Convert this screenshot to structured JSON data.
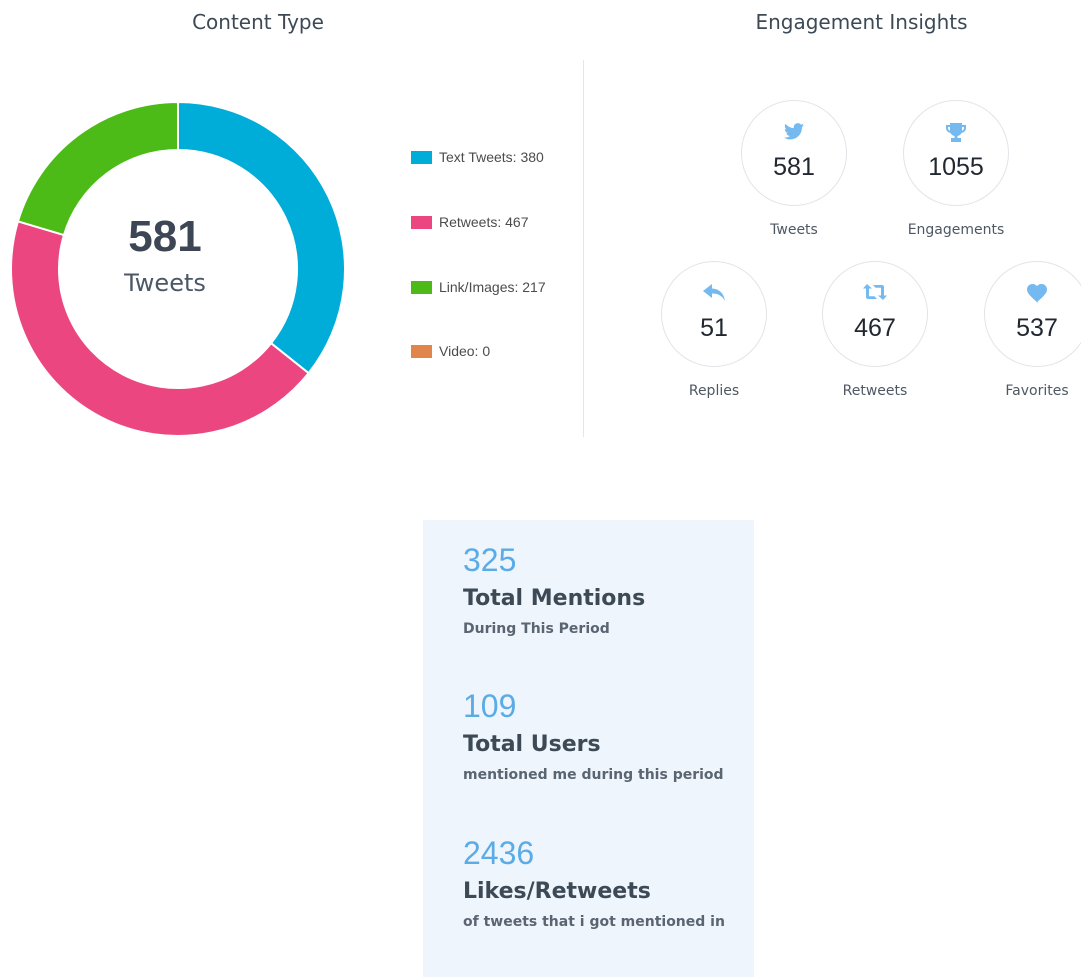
{
  "content_type": {
    "title": "Content Type",
    "total": "581",
    "total_label": "Tweets",
    "legend": [
      {
        "label": "Text Tweets: 380",
        "color": "#00acd8"
      },
      {
        "label": "Retweets: 467",
        "color": "#ec4680"
      },
      {
        "label": "Link/Images: 217",
        "color": "#4cbb17"
      },
      {
        "label": "Video: 0",
        "color": "#e0864a"
      }
    ]
  },
  "chart_data": {
    "type": "pie",
    "categories": [
      "Text Tweets",
      "Retweets",
      "Link/Images",
      "Video"
    ],
    "values": [
      380,
      467,
      217,
      0
    ],
    "colors": [
      "#00acd8",
      "#ec4680",
      "#4cbb17",
      "#e0864a"
    ],
    "donut": true,
    "legend_position": "right"
  },
  "engagement": {
    "title": "Engagement Insights",
    "stats": [
      {
        "value": "581",
        "label": "Tweets",
        "icon": "twitter-bird-icon"
      },
      {
        "value": "1055",
        "label": "Engagements",
        "icon": "trophy-icon"
      },
      {
        "value": "51",
        "label": "Replies",
        "icon": "reply-icon"
      },
      {
        "value": "467",
        "label": "Retweets",
        "icon": "retweet-icon"
      },
      {
        "value": "537",
        "label": "Favorites",
        "icon": "heart-icon"
      }
    ],
    "icon_color": "#74b9ef"
  },
  "mentions": {
    "items": [
      {
        "number": "325",
        "title": "Total Mentions",
        "desc": "During This Period"
      },
      {
        "number": "109",
        "title": "Total Users",
        "desc": "mentioned me during this period"
      },
      {
        "number": "2436",
        "title": "Likes/Retweets",
        "desc": "of tweets that i got mentioned in"
      }
    ]
  }
}
